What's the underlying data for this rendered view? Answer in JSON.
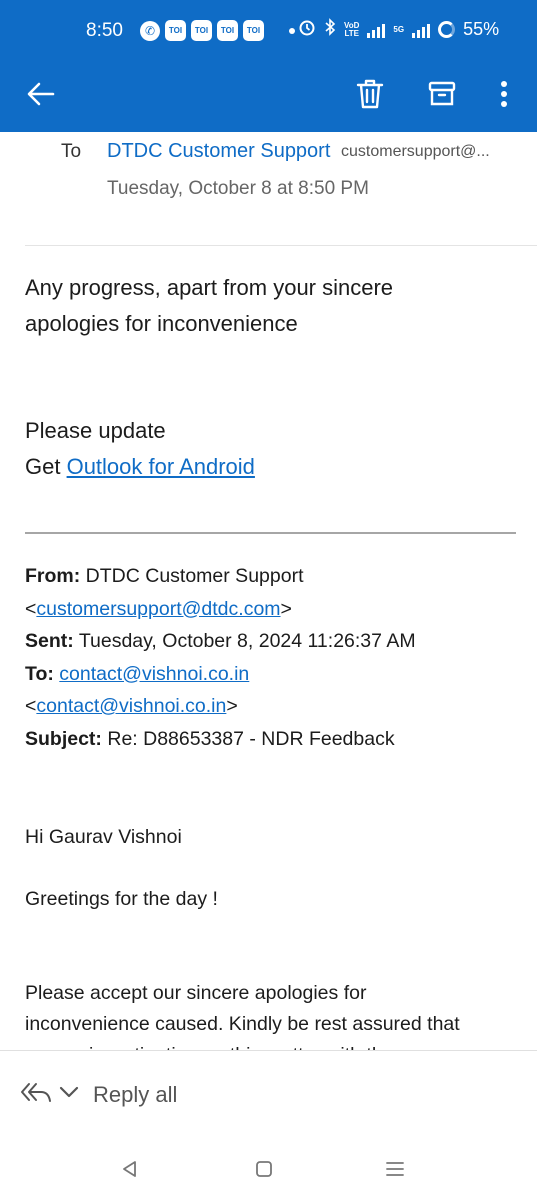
{
  "status_bar": {
    "time": "8:50",
    "toi_badges": [
      "TOI",
      "TOI",
      "TOI",
      "TOI"
    ],
    "network_label_top": "VoD",
    "network_label_bottom": "LTE",
    "network_5g": "5G",
    "battery_percent": "55%"
  },
  "colors": {
    "accent": "#0f6cc6",
    "link": "#0f6cc6",
    "text": "#1c1c1c"
  },
  "toolbar": {
    "icons": [
      "back-arrow-icon",
      "trash-icon",
      "archive-icon",
      "more-vertical-icon"
    ]
  },
  "email_header": {
    "to_label": "To",
    "to_name": "DTDC Customer Support",
    "to_email": "customersupport@...",
    "date": "Tuesday, October 8 at 8:50 PM"
  },
  "body": {
    "line1": "Any progress, apart from your sincere",
    "line2": "apologies for inconvenience",
    "line3": "Please update",
    "get_prefix": "Get ",
    "outlook_link": "Outlook for Android"
  },
  "quoted": {
    "from_label": "From:",
    "from_name": " DTDC Customer Support",
    "from_email_open": "<",
    "from_email": "customersupport@dtdc.com",
    "from_email_close": ">",
    "sent_label": "Sent:",
    "sent_value": " Tuesday, October 8, 2024 11:26:37 AM",
    "to_label": "To:",
    "to_email": "contact@vishnoi.co.in",
    "to_email_open": "<",
    "to_email2": "contact@vishnoi.co.in",
    "to_email_close": ">",
    "subject_label": "Subject:",
    "subject_value": " Re: D88653387 - NDR Feedback",
    "greeting": "Hi  Gaurav Vishnoi",
    "greetings_day": "Greetings for the day !",
    "para_line1": "Please accept our sincere apologies for",
    "para_line2": "inconvenience caused. Kindly be rest assured that",
    "para_line3": "we are investigating on this matter with the"
  },
  "reply_bar": {
    "label": "Reply all"
  }
}
